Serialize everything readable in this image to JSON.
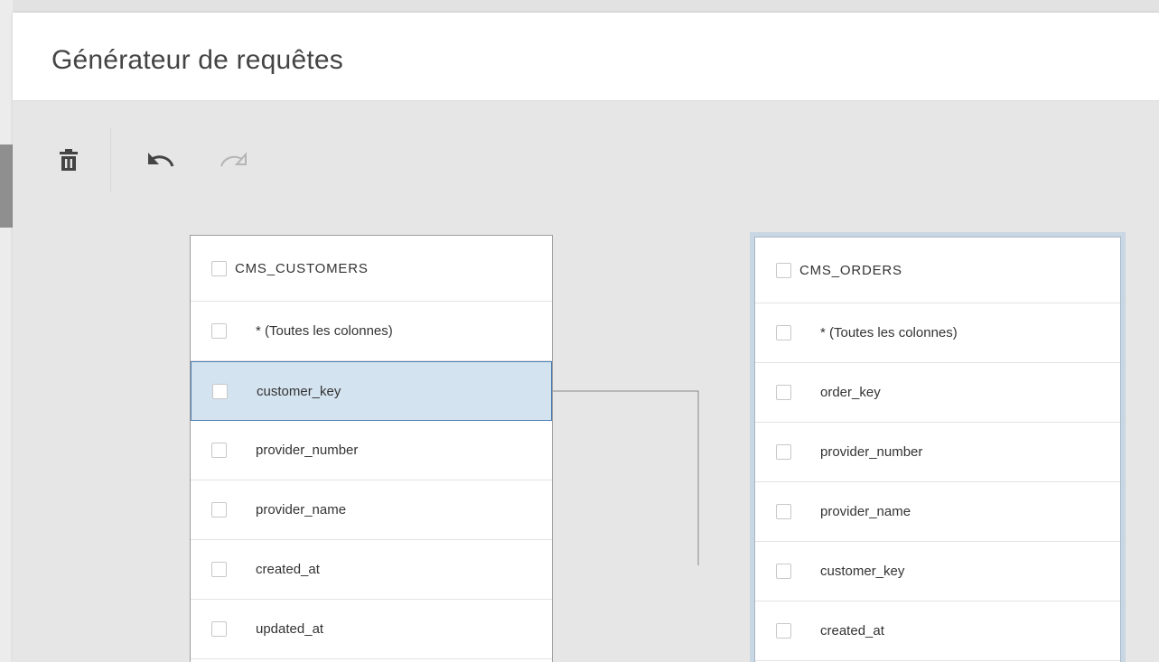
{
  "dialog": {
    "title": "Générateur de requêtes"
  },
  "toolbar": {
    "buttons": [
      {
        "icon": "trash-icon",
        "enabled": true
      },
      {
        "icon": "undo-icon",
        "enabled": true
      },
      {
        "icon": "redo-icon",
        "enabled": false
      }
    ]
  },
  "colors": {
    "highlight_row_bg": "#d4e3f0",
    "highlight_row_border": "#4d7fb5",
    "selected_table_outline": "#c9d6e3",
    "link_line": "#8a8a8a"
  },
  "tables": [
    {
      "name": "CMS_CUSTOMERS",
      "selected": false,
      "rows": [
        {
          "label": "* (Toutes les colonnes)",
          "highlighted": false
        },
        {
          "label": "customer_key",
          "highlighted": true
        },
        {
          "label": "provider_number",
          "highlighted": false
        },
        {
          "label": "provider_name",
          "highlighted": false
        },
        {
          "label": "created_at",
          "highlighted": false
        },
        {
          "label": "updated_at",
          "highlighted": false
        }
      ]
    },
    {
      "name": "CMS_ORDERS",
      "selected": true,
      "rows": [
        {
          "label": "* (Toutes les colonnes)",
          "highlighted": false
        },
        {
          "label": "order_key",
          "highlighted": false
        },
        {
          "label": "provider_number",
          "highlighted": false
        },
        {
          "label": "provider_name",
          "highlighted": false
        },
        {
          "label": "customer_key",
          "highlighted": false
        },
        {
          "label": "created_at",
          "highlighted": false
        }
      ]
    }
  ]
}
